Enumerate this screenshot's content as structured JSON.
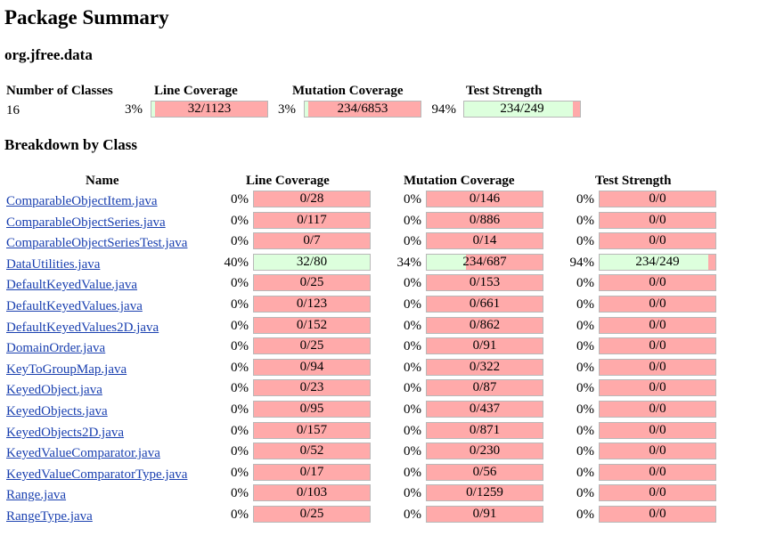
{
  "title": "Package Summary",
  "package_name": "org.jfree.data",
  "summary": {
    "headers": {
      "classes": "Number of Classes",
      "line": "Line Coverage",
      "mutation": "Mutation Coverage",
      "strength": "Test Strength"
    },
    "classes": "16",
    "line": {
      "pct": "3%",
      "label": "32/1123",
      "fraction": 0.03
    },
    "mutation": {
      "pct": "3%",
      "label": "234/6853",
      "fraction": 0.03
    },
    "strength": {
      "pct": "94%",
      "label": "234/249",
      "fraction": 0.94
    }
  },
  "breakdown_title": "Breakdown by Class",
  "breakdown_headers": {
    "name": "Name",
    "line": "Line Coverage",
    "mutation": "Mutation Coverage",
    "strength": "Test Strength"
  },
  "rows": [
    {
      "name": "ComparableObjectItem.java",
      "line": {
        "pct": "0%",
        "label": "0/28",
        "fraction": 0
      },
      "mutation": {
        "pct": "0%",
        "label": "0/146",
        "fraction": 0
      },
      "strength": {
        "pct": "0%",
        "label": "0/0",
        "fraction": 0
      }
    },
    {
      "name": "ComparableObjectSeries.java",
      "line": {
        "pct": "0%",
        "label": "0/117",
        "fraction": 0
      },
      "mutation": {
        "pct": "0%",
        "label": "0/886",
        "fraction": 0
      },
      "strength": {
        "pct": "0%",
        "label": "0/0",
        "fraction": 0
      }
    },
    {
      "name": "ComparableObjectSeriesTest.java",
      "line": {
        "pct": "0%",
        "label": "0/7",
        "fraction": 0
      },
      "mutation": {
        "pct": "0%",
        "label": "0/14",
        "fraction": 0
      },
      "strength": {
        "pct": "0%",
        "label": "0/0",
        "fraction": 0
      }
    },
    {
      "name": "DataUtilities.java",
      "line": {
        "pct": "40%",
        "label": "32/80",
        "fraction": 1.0
      },
      "mutation": {
        "pct": "34%",
        "label": "234/687",
        "fraction": 0.34
      },
      "strength": {
        "pct": "94%",
        "label": "234/249",
        "fraction": 0.94
      }
    },
    {
      "name": "DefaultKeyedValue.java",
      "line": {
        "pct": "0%",
        "label": "0/25",
        "fraction": 0
      },
      "mutation": {
        "pct": "0%",
        "label": "0/153",
        "fraction": 0
      },
      "strength": {
        "pct": "0%",
        "label": "0/0",
        "fraction": 0
      }
    },
    {
      "name": "DefaultKeyedValues.java",
      "line": {
        "pct": "0%",
        "label": "0/123",
        "fraction": 0
      },
      "mutation": {
        "pct": "0%",
        "label": "0/661",
        "fraction": 0
      },
      "strength": {
        "pct": "0%",
        "label": "0/0",
        "fraction": 0
      }
    },
    {
      "name": "DefaultKeyedValues2D.java",
      "line": {
        "pct": "0%",
        "label": "0/152",
        "fraction": 0
      },
      "mutation": {
        "pct": "0%",
        "label": "0/862",
        "fraction": 0
      },
      "strength": {
        "pct": "0%",
        "label": "0/0",
        "fraction": 0
      }
    },
    {
      "name": "DomainOrder.java",
      "line": {
        "pct": "0%",
        "label": "0/25",
        "fraction": 0
      },
      "mutation": {
        "pct": "0%",
        "label": "0/91",
        "fraction": 0
      },
      "strength": {
        "pct": "0%",
        "label": "0/0",
        "fraction": 0
      }
    },
    {
      "name": "KeyToGroupMap.java",
      "line": {
        "pct": "0%",
        "label": "0/94",
        "fraction": 0
      },
      "mutation": {
        "pct": "0%",
        "label": "0/322",
        "fraction": 0
      },
      "strength": {
        "pct": "0%",
        "label": "0/0",
        "fraction": 0
      }
    },
    {
      "name": "KeyedObject.java",
      "line": {
        "pct": "0%",
        "label": "0/23",
        "fraction": 0
      },
      "mutation": {
        "pct": "0%",
        "label": "0/87",
        "fraction": 0
      },
      "strength": {
        "pct": "0%",
        "label": "0/0",
        "fraction": 0
      }
    },
    {
      "name": "KeyedObjects.java",
      "line": {
        "pct": "0%",
        "label": "0/95",
        "fraction": 0
      },
      "mutation": {
        "pct": "0%",
        "label": "0/437",
        "fraction": 0
      },
      "strength": {
        "pct": "0%",
        "label": "0/0",
        "fraction": 0
      }
    },
    {
      "name": "KeyedObjects2D.java",
      "line": {
        "pct": "0%",
        "label": "0/157",
        "fraction": 0
      },
      "mutation": {
        "pct": "0%",
        "label": "0/871",
        "fraction": 0
      },
      "strength": {
        "pct": "0%",
        "label": "0/0",
        "fraction": 0
      }
    },
    {
      "name": "KeyedValueComparator.java",
      "line": {
        "pct": "0%",
        "label": "0/52",
        "fraction": 0
      },
      "mutation": {
        "pct": "0%",
        "label": "0/230",
        "fraction": 0
      },
      "strength": {
        "pct": "0%",
        "label": "0/0",
        "fraction": 0
      }
    },
    {
      "name": "KeyedValueComparatorType.java",
      "line": {
        "pct": "0%",
        "label": "0/17",
        "fraction": 0
      },
      "mutation": {
        "pct": "0%",
        "label": "0/56",
        "fraction": 0
      },
      "strength": {
        "pct": "0%",
        "label": "0/0",
        "fraction": 0
      }
    },
    {
      "name": "Range.java",
      "line": {
        "pct": "0%",
        "label": "0/103",
        "fraction": 0
      },
      "mutation": {
        "pct": "0%",
        "label": "0/1259",
        "fraction": 0
      },
      "strength": {
        "pct": "0%",
        "label": "0/0",
        "fraction": 0
      }
    },
    {
      "name": "RangeType.java",
      "line": {
        "pct": "0%",
        "label": "0/25",
        "fraction": 0
      },
      "mutation": {
        "pct": "0%",
        "label": "0/91",
        "fraction": 0
      },
      "strength": {
        "pct": "0%",
        "label": "0/0",
        "fraction": 0
      }
    }
  ],
  "colors": {
    "uncovered": "#ffaaaa",
    "covered": "#ddffdd",
    "link": "#1a40b0"
  }
}
